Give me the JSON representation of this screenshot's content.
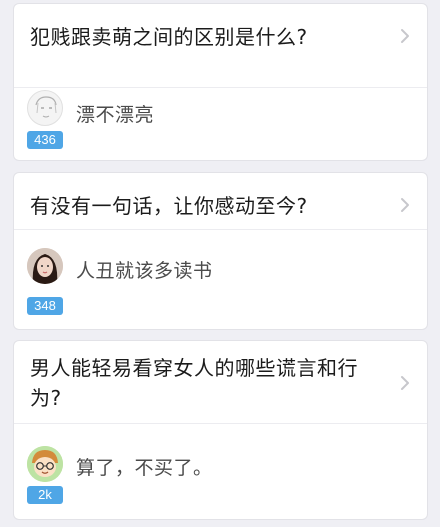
{
  "feed": [
    {
      "question": "犯贱跟卖萌之间的区别是什么?",
      "answer": "漂不漂亮",
      "votes": "436",
      "avatar_icon": "sketch-face-avatar"
    },
    {
      "question": "有没有一句话，让你感动至今?",
      "answer": "人丑就该多读书",
      "votes": "348",
      "avatar_icon": "woman-photo-avatar"
    },
    {
      "question": "男人能轻易看穿女人的哪些谎言和行为?",
      "answer": "算了，不买了。",
      "votes": "2k",
      "avatar_icon": "cartoon-boy-avatar"
    }
  ],
  "colors": {
    "badge": "#4fa6e6",
    "background": "#efeff4"
  }
}
